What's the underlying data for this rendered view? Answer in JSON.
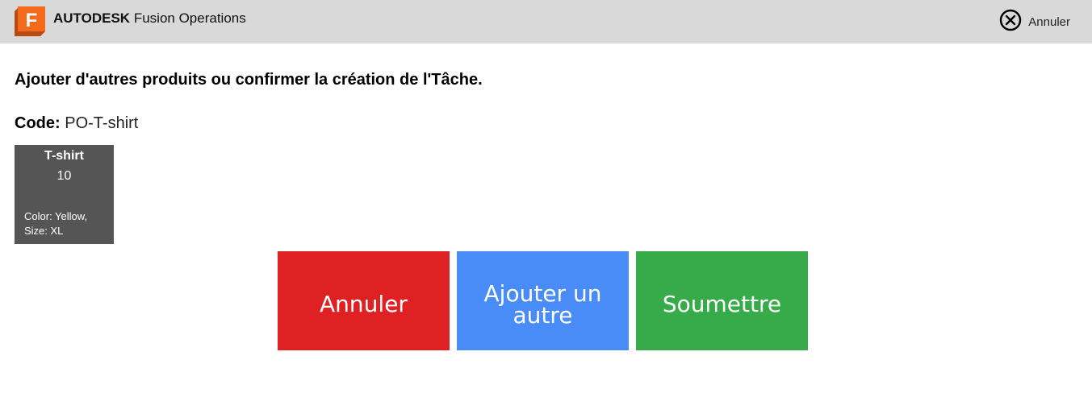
{
  "header": {
    "brand_bold": "AUTODESK",
    "brand_rest": "Fusion Operations",
    "logo_letter": "F",
    "logo_icon": "fusion-logo-icon",
    "cancel_label": "Annuler",
    "cancel_icon": "close-circle-icon"
  },
  "main": {
    "headline": "Ajouter d'autres produits ou confirmer la création de l'Tâche.",
    "code_label": "Code:",
    "code_value": "PO-T-shirt",
    "product": {
      "name": "T-shirt",
      "quantity": "10",
      "attributes_line1": "Color: Yellow,",
      "attributes_line2": "Size: XL"
    }
  },
  "actions": {
    "cancel_label": "Annuler",
    "add_label": "Ajouter un autre",
    "submit_label": "Soumettre"
  },
  "colors": {
    "topbar": "#d9d9d9",
    "tile": "#555555",
    "cancel": "#e02124",
    "add": "#4a8cf7",
    "submit": "#37ab4a",
    "logo_orange": "#f26b1d"
  }
}
